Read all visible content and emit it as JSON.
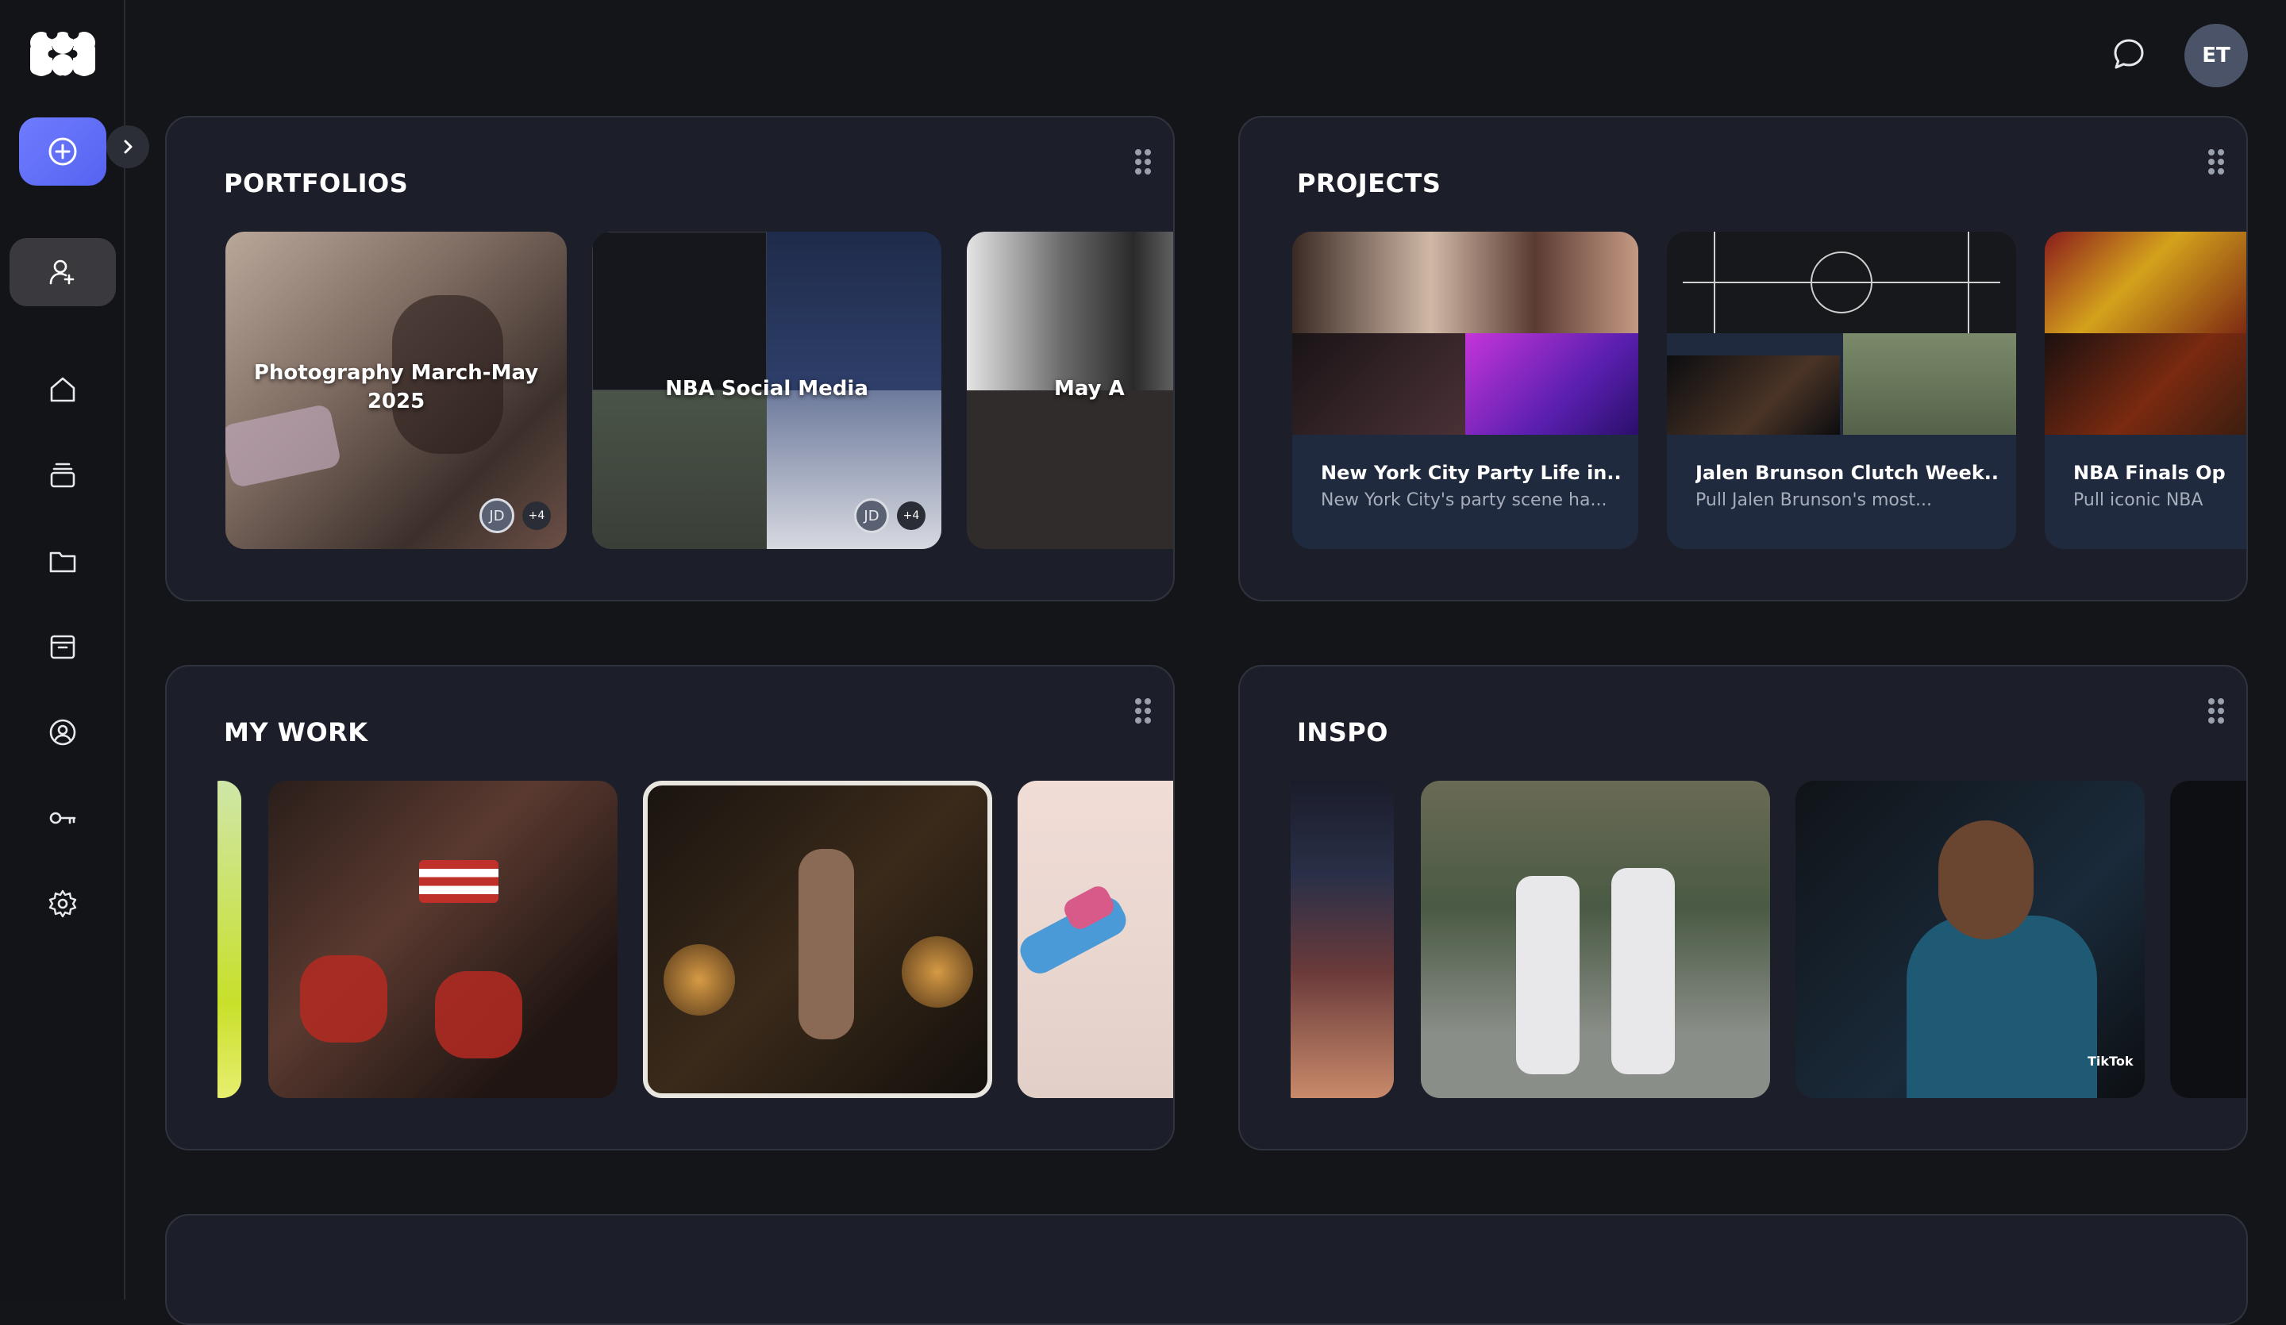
{
  "topbar": {
    "avatar_initials": "ET"
  },
  "portfolios": {
    "title": "PORTFOLIOS",
    "cards": [
      {
        "title": "Photography March-May 2025",
        "member_initials": "JD",
        "more": "+4"
      },
      {
        "title": "NBA Social Media",
        "member_initials": "JD",
        "more": "+4"
      },
      {
        "title": "May A"
      }
    ]
  },
  "projects": {
    "title": "PROJECTS",
    "cards": [
      {
        "title": "New York City Party Life in...",
        "desc": "New York City's party scene ha..."
      },
      {
        "title": "Jalen Brunson Clutch Week...",
        "desc": "Pull Jalen Brunson's most..."
      },
      {
        "title": "NBA Finals Op",
        "desc": "Pull iconic NBA"
      }
    ]
  },
  "my_work": {
    "title": "MY WORK"
  },
  "inspo": {
    "title": "INSPO",
    "tiktok_label": "TikTok"
  },
  "colors": {
    "accent": "#5f6cf7",
    "panel_bg": "#1c1f29",
    "page_bg": "#141519"
  }
}
